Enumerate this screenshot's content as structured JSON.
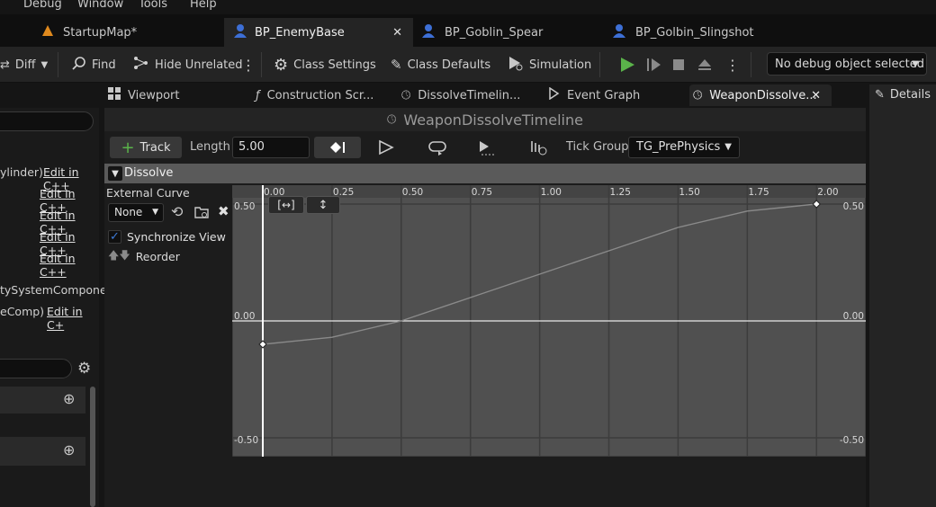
{
  "menu": [
    "Debug",
    "Window",
    "Tools",
    "Help"
  ],
  "doc_tabs": [
    {
      "label": "StartupMap*"
    },
    {
      "label": "BP_EnemyBase"
    },
    {
      "label": "BP_Goblin_Spear"
    },
    {
      "label": "BP_Golbin_Slingshot"
    }
  ],
  "toolbar": {
    "diff": "Diff",
    "find": "Find",
    "hide_unrelated": "Hide Unrelated",
    "class_settings": "Class Settings",
    "class_defaults": "Class Defaults",
    "simulation": "Simulation",
    "debug_object": "No debug object selected"
  },
  "panel_tabs": [
    {
      "label": "Viewport"
    },
    {
      "label": "Construction Scr..."
    },
    {
      "label": "DissolveTimelin..."
    },
    {
      "label": "Event Graph"
    },
    {
      "label": "WeaponDissolve..."
    }
  ],
  "details_tab": "Details",
  "left_panel": {
    "rows": [
      {
        "prefix": "ylinder)",
        "link": "Edit in C++"
      },
      {
        "prefix": "",
        "link": "Edit in C++"
      },
      {
        "prefix": "",
        "link": "Edit in C++"
      },
      {
        "prefix": "",
        "link": "Edit in C++"
      },
      {
        "prefix": "",
        "link": "Edit in C++"
      }
    ],
    "component_1": "tySystemCompone",
    "component_2": "eComp)",
    "component_2_link": "Edit in C+"
  },
  "timeline": {
    "title": "WeaponDissolveTimeline",
    "track_button": "Track",
    "length_label": "Length",
    "length_value": "5.00",
    "tick_group_label": "Tick Group",
    "tick_group_value": "TG_PrePhysics",
    "track_name": "Dissolve",
    "external_curve_label": "External Curve",
    "external_curve_value": "None",
    "sync_view_label": "Synchronize View",
    "sync_view_checked": true,
    "reorder_label": "Reorder"
  },
  "chart_data": {
    "type": "line",
    "x_ticks": [
      "0.00",
      "0.25",
      "0.50",
      "0.75",
      "1.00",
      "1.25",
      "1.50",
      "1.75",
      "2.00"
    ],
    "y_ticks": [
      "0.50",
      "0.00",
      "-0.50"
    ],
    "xlim": [
      0,
      2.1
    ],
    "ylim": [
      -0.55,
      0.55
    ],
    "keys": [
      {
        "x": 0.0,
        "y": -0.1
      },
      {
        "x": 2.0,
        "y": 0.5
      }
    ],
    "series": [
      {
        "x": [
          0.0,
          0.25,
          0.5,
          0.75,
          1.0,
          1.25,
          1.5,
          1.75,
          2.0
        ],
        "y": [
          -0.1,
          -0.07,
          0.0,
          0.1,
          0.2,
          0.3,
          0.4,
          0.47,
          0.5
        ]
      }
    ],
    "colors": {
      "curve": "#8a8a8a",
      "grid": "#3c3c3c",
      "plot_bg": "#4a4a4a",
      "key": "#ffffff"
    }
  },
  "colors": {
    "accent": "#3d7ad6",
    "play_green": "#5ab34a"
  }
}
